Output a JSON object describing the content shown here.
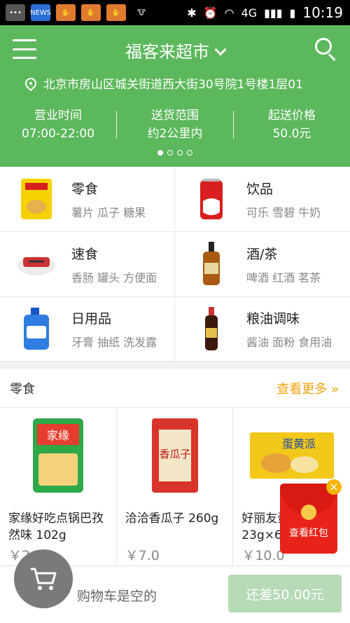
{
  "status_bar": {
    "network": "4G",
    "time": "10:19",
    "news_label": "NEWS"
  },
  "header": {
    "store_name": "福客来超市",
    "address": "北京市房山区城关街道西大街30号院1号楼1层01",
    "info": [
      {
        "label": "营业时间",
        "value": "07:00-22:00"
      },
      {
        "label": "送货范围",
        "value": "约2公里内"
      },
      {
        "label": "起送价格",
        "value": "50.0元"
      }
    ]
  },
  "categories": [
    {
      "name": "零食",
      "sub": "薯片 瓜子 糖果",
      "icon": "chips-bag-icon"
    },
    {
      "name": "饮品",
      "sub": "可乐 雪碧 牛奶",
      "icon": "cola-can-icon"
    },
    {
      "name": "速食",
      "sub": "香肠 罐头 方便面",
      "icon": "instant-food-icon"
    },
    {
      "name": "酒/茶",
      "sub": "啤酒 红酒 茗茶",
      "icon": "liquor-bottle-icon"
    },
    {
      "name": "日用品",
      "sub": "牙膏 抽纸 洗发露",
      "icon": "detergent-icon"
    },
    {
      "name": "粮油调味",
      "sub": "酱油 面粉 食用油",
      "icon": "soy-sauce-icon"
    }
  ],
  "section": {
    "title": "零食",
    "more_label": "查看更多 »",
    "products": [
      {
        "name": "家缘好吃点锅巴孜然味 102g",
        "price": "￥2.0",
        "img_label": "家缘"
      },
      {
        "name": "洽洽香瓜子 260g",
        "price": "￥7.0",
        "img_label": "香瓜子"
      },
      {
        "name": "好丽友蛋黄派 23g×6",
        "price": "￥10.0",
        "img_label": "蛋黄派"
      }
    ]
  },
  "red_packet": {
    "label": "查看红包"
  },
  "cart": {
    "empty_text": "购物车是空的",
    "checkout_label": "还差50.00元"
  },
  "colors": {
    "brand_green": "#5cb85c",
    "accent_orange": "#f0a30a",
    "checkout_disabled": "#b6dbb6"
  }
}
